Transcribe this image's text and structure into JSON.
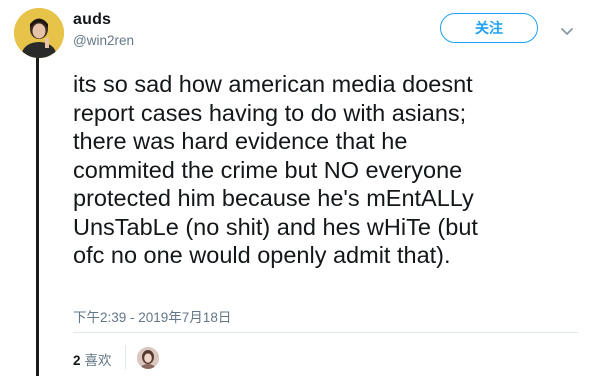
{
  "user": {
    "display_name": "auds",
    "handle": "@win2ren"
  },
  "follow_button": {
    "label": "关注",
    "color": "#1da1f2"
  },
  "tweet": {
    "lines": [
      "its so sad how american media doesnt",
      "report cases having to do with asians;",
      "there was hard evidence that he",
      "commited the crime but NO everyone",
      "protected him because he's mEntALLy",
      "UnsTabLe (no shit) and hes wHiTe (but",
      "ofc no one would openly admit that)."
    ],
    "timestamp": "下午2:39 - 2019年7月18日"
  },
  "likes": {
    "count": "2",
    "label": "喜欢"
  },
  "icons": {
    "menu": "chevron-down-icon",
    "avatar": "user-avatar",
    "liker": "liker-avatar"
  },
  "colors": {
    "name": "#14171a",
    "secondary": "#657786",
    "accent": "#1da1f2",
    "thread_line": "#1a1a1a"
  }
}
